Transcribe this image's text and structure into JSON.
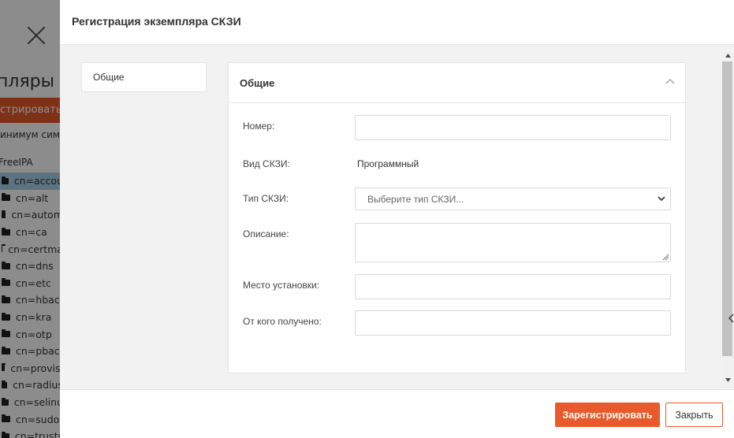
{
  "background": {
    "title": "пляры С",
    "action_button": "стрировать",
    "filter_hint": "инимум сим",
    "tree_root": "FreeIPA",
    "tree_items": [
      {
        "label": "cn=accou"
      },
      {
        "label": "cn=alt"
      },
      {
        "label": "cn=autom"
      },
      {
        "label": "cn=ca"
      },
      {
        "label": "cn=certma"
      },
      {
        "label": "cn=dns"
      },
      {
        "label": "cn=etc"
      },
      {
        "label": "cn=hbac"
      },
      {
        "label": "cn=kra"
      },
      {
        "label": "cn=otp"
      },
      {
        "label": "cn=pbac"
      },
      {
        "label": "cn=provisi"
      },
      {
        "label": "cn=radius"
      },
      {
        "label": "cn=selinu"
      },
      {
        "label": "cn=sudo"
      },
      {
        "label": "cn=trusts"
      }
    ]
  },
  "modal": {
    "title": "Регистрация экземпляра СКЗИ",
    "nav": [
      {
        "label": "Общие"
      }
    ],
    "section_title": "Общие",
    "fields": {
      "number": {
        "label": "Номер:",
        "value": ""
      },
      "type_label": {
        "label": "Вид СКЗИ:",
        "value": "Программный"
      },
      "skzi_type": {
        "label": "Тип СКЗИ:",
        "placeholder": "Выберите тип СКЗИ..."
      },
      "description": {
        "label": "Описание:",
        "value": ""
      },
      "location": {
        "label": "Место установки:",
        "value": ""
      },
      "received_from": {
        "label": "От кого получено:",
        "value": ""
      }
    },
    "footer": {
      "register_label": "Зарегистрировать",
      "close_label": "Закрыть"
    }
  },
  "colors": {
    "accent": "#e85a2b",
    "selected_tree": "#a9d1ea",
    "overlay": "rgba(0,0,0,0.45)"
  },
  "icons": {
    "background_close": "close-icon",
    "section_toggle": "chevron-up-icon",
    "select_arrow": "chevron-down-icon",
    "folder": "folder-icon"
  }
}
